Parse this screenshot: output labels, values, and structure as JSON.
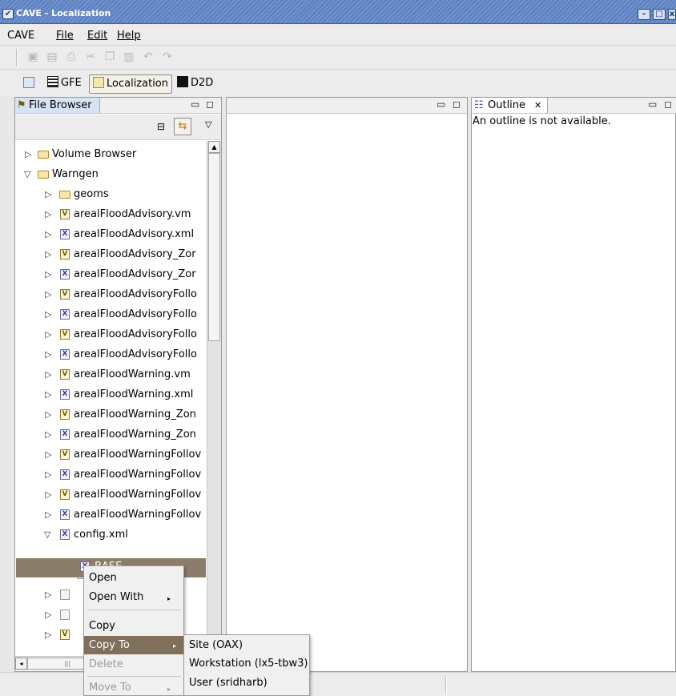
{
  "window": {
    "title": "CAVE - Localization"
  },
  "menubar": {
    "items": [
      "CAVE",
      "File",
      "Edit",
      "Help"
    ]
  },
  "toolbar": {
    "icons": [
      "save-icon",
      "save-all-icon",
      "print-icon",
      "cut-icon",
      "copy-icon",
      "paste-icon",
      "undo-icon",
      "redo-icon"
    ]
  },
  "perspectives": {
    "items": [
      {
        "label": "GFE"
      },
      {
        "label": "Localization",
        "active": true
      },
      {
        "label": "D2D"
      }
    ]
  },
  "file_browser": {
    "title": "File Browser",
    "tree": [
      {
        "label": "Volume Browser",
        "indent": 1,
        "expanded": false,
        "icon": "folder"
      },
      {
        "label": "Warngen",
        "indent": 1,
        "expanded": true,
        "icon": "folder"
      },
      {
        "label": "geoms",
        "indent": 2,
        "expanded": false,
        "icon": "folder"
      },
      {
        "label": "arealFloodAdvisory.vm",
        "indent": 2,
        "expanded": false,
        "icon": "vm"
      },
      {
        "label": "arealFloodAdvisory.xml",
        "indent": 2,
        "expanded": false,
        "icon": "xml"
      },
      {
        "label": "arealFloodAdvisory_Zor",
        "indent": 2,
        "expanded": false,
        "icon": "vm"
      },
      {
        "label": "arealFloodAdvisory_Zor",
        "indent": 2,
        "expanded": false,
        "icon": "xml"
      },
      {
        "label": "arealFloodAdvisoryFollo",
        "indent": 2,
        "expanded": false,
        "icon": "vm"
      },
      {
        "label": "arealFloodAdvisoryFollo",
        "indent": 2,
        "expanded": false,
        "icon": "xml"
      },
      {
        "label": "arealFloodAdvisoryFollo",
        "indent": 2,
        "expanded": false,
        "icon": "vm"
      },
      {
        "label": "arealFloodAdvisoryFollo",
        "indent": 2,
        "expanded": false,
        "icon": "xml"
      },
      {
        "label": "arealFloodWarning.vm",
        "indent": 2,
        "expanded": false,
        "icon": "vm"
      },
      {
        "label": "arealFloodWarning.xml",
        "indent": 2,
        "expanded": false,
        "icon": "xml"
      },
      {
        "label": "arealFloodWarning_Zon",
        "indent": 2,
        "expanded": false,
        "icon": "vm"
      },
      {
        "label": "arealFloodWarning_Zon",
        "indent": 2,
        "expanded": false,
        "icon": "xml"
      },
      {
        "label": "arealFloodWarningFollov",
        "indent": 2,
        "expanded": false,
        "icon": "vm"
      },
      {
        "label": "arealFloodWarningFollov",
        "indent": 2,
        "expanded": false,
        "icon": "xml"
      },
      {
        "label": "arealFloodWarningFollov",
        "indent": 2,
        "expanded": false,
        "icon": "vm"
      },
      {
        "label": "arealFloodWarningFollov",
        "indent": 2,
        "expanded": false,
        "icon": "xml"
      },
      {
        "label": "config.xml",
        "indent": 2,
        "expanded": true,
        "icon": "xml"
      },
      {
        "label": "BASE",
        "indent": 3,
        "icon": "xml",
        "selected": true
      }
    ]
  },
  "outline": {
    "title": "Outline",
    "message": "An outline is not available."
  },
  "context_menu": {
    "items": [
      "Open",
      "Open With",
      "Copy",
      "Copy To",
      "Delete",
      "Move To"
    ],
    "highlighted": "Copy To"
  },
  "submenu": {
    "items": [
      "Site (OAX)",
      "Workstation (lx5-tbw3)",
      "User (sridharb)"
    ]
  }
}
